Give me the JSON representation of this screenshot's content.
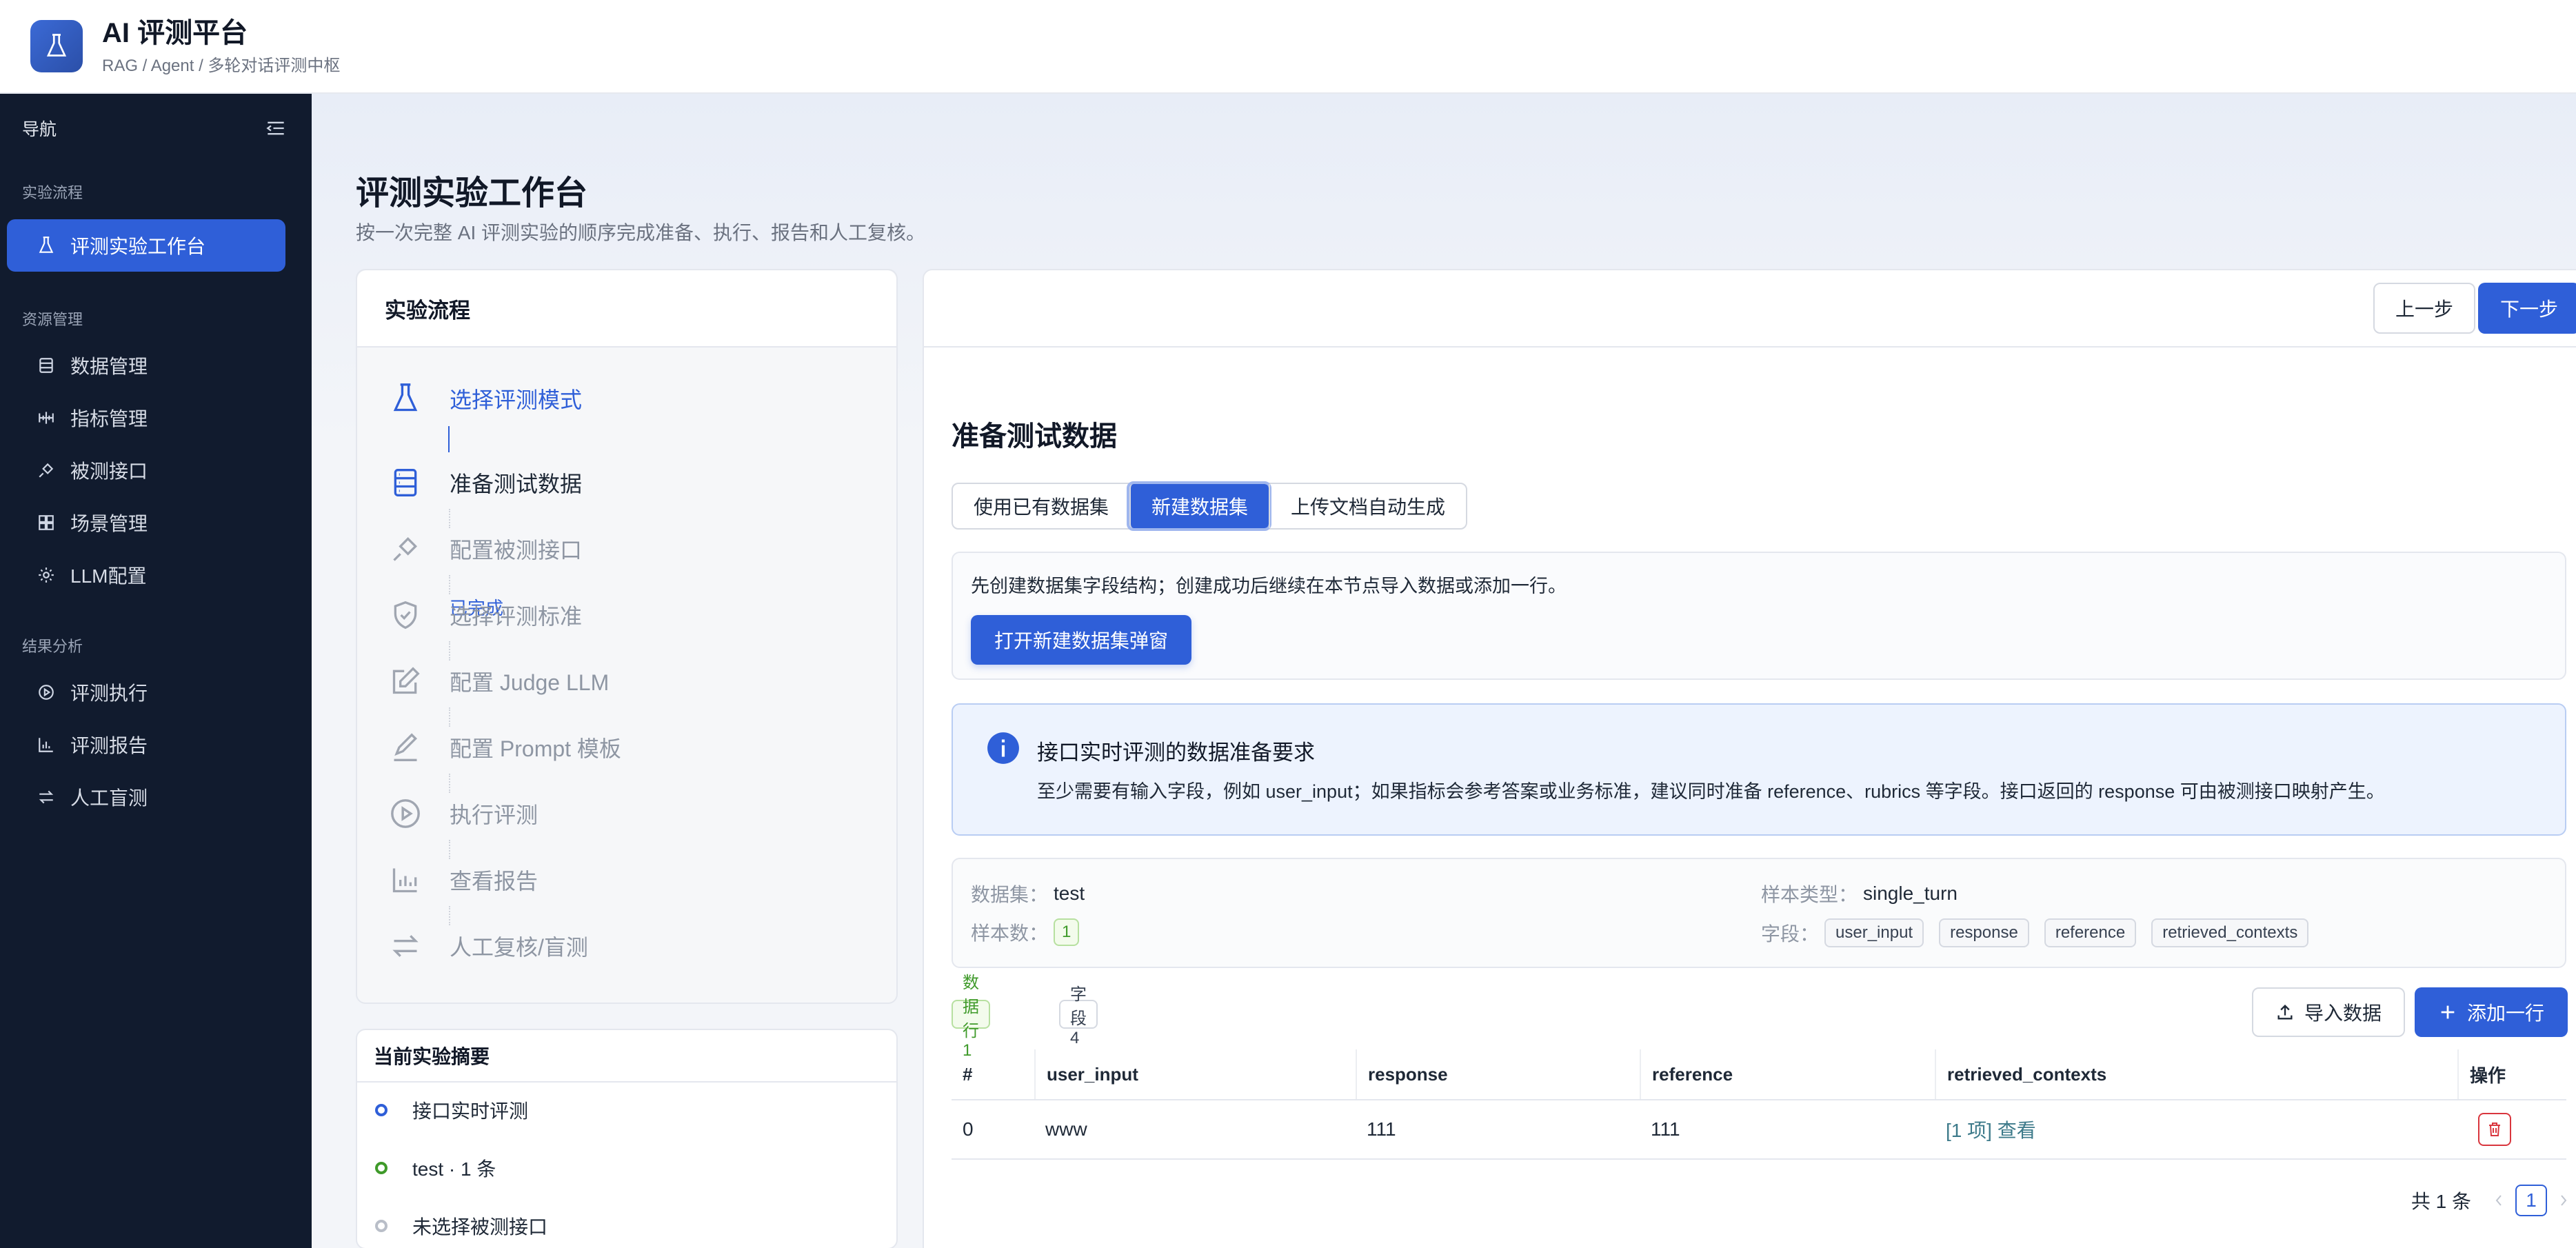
{
  "header": {
    "title": "AI 评测平台",
    "subtitle": "RAG / Agent / 多轮对话评测中枢"
  },
  "sidebar": {
    "nav_label": "导航",
    "sections": [
      {
        "label": "实验流程",
        "items": [
          {
            "label": "评测实验工作台",
            "icon": "flask-icon",
            "active": true
          }
        ]
      },
      {
        "label": "资源管理",
        "items": [
          {
            "label": "数据管理",
            "icon": "database-icon"
          },
          {
            "label": "指标管理",
            "icon": "metric-icon"
          },
          {
            "label": "被测接口",
            "icon": "plug-icon"
          },
          {
            "label": "场景管理",
            "icon": "grid-icon"
          },
          {
            "label": "LLM配置",
            "icon": "gear-icon"
          }
        ]
      },
      {
        "label": "结果分析",
        "items": [
          {
            "label": "评测执行",
            "icon": "play-icon"
          },
          {
            "label": "评测报告",
            "icon": "bar-chart-icon"
          },
          {
            "label": "人工盲测",
            "icon": "swap-icon"
          }
        ]
      }
    ]
  },
  "page": {
    "title": "评测实验工作台",
    "subtitle": "按一次完整 AI 评测实验的顺序完成准备、执行、报告和人工复核。"
  },
  "flow": {
    "title": "实验流程",
    "steps": [
      {
        "label": "选择评测模式",
        "status": "已完成",
        "icon": "flask-icon"
      },
      {
        "label": "准备测试数据",
        "icon": "database-icon"
      },
      {
        "label": "配置被测接口",
        "icon": "plug-icon"
      },
      {
        "label": "选择评测标准",
        "icon": "shield-check-icon"
      },
      {
        "label": "配置 Judge LLM",
        "icon": "edit-icon"
      },
      {
        "label": "配置 Prompt 模板",
        "icon": "pen-icon"
      },
      {
        "label": "执行评测",
        "icon": "play-icon"
      },
      {
        "label": "查看报告",
        "icon": "bar-chart-icon"
      },
      {
        "label": "人工复核/盲测",
        "icon": "swap-icon"
      }
    ]
  },
  "summary": {
    "title": "当前实验摘要",
    "items": [
      {
        "label": "接口实时评测",
        "color": "#2f5fd8"
      },
      {
        "label": "test · 1 条",
        "color": "#3f9a2a"
      },
      {
        "label": "未选择被测接口",
        "color": "#b9bec8"
      }
    ]
  },
  "toolbar": {
    "prev": "上一步",
    "next": "下一步"
  },
  "section": {
    "title": "准备测试数据",
    "modes": [
      "使用已有数据集",
      "新建数据集",
      "上传文档自动生成"
    ],
    "active_mode": "新建数据集"
  },
  "create": {
    "text": "先创建数据集字段结构；创建成功后继续在本节点导入数据或添加一行。",
    "button": "打开新建数据集弹窗"
  },
  "info": {
    "title": "接口实时评测的数据准备要求",
    "text": "至少需要有输入字段，例如 user_input；如果指标会参考答案或业务标准，建议同时准备 reference、rubrics 等字段。接口返回的 response 可由被测接口映射产生。"
  },
  "meta": {
    "dataset_label": "数据集：",
    "dataset": "test",
    "type_label": "样本类型：",
    "type": "single_turn",
    "count_label": "样本数：",
    "count": "1",
    "fields_label": "字段：",
    "fields": [
      "user_input",
      "response",
      "reference",
      "retrieved_contexts"
    ]
  },
  "tools": {
    "rows_tag": "数据行 1",
    "fields_tag": "字段 4",
    "import": "导入数据",
    "add": "添加一行"
  },
  "table": {
    "headers": [
      "#",
      "user_input",
      "response",
      "reference",
      "retrieved_contexts",
      "操作"
    ],
    "rows": [
      {
        "idx": "0",
        "user_input": "www",
        "response": "111",
        "reference": "111",
        "contexts": "[1 项] 查看"
      }
    ]
  },
  "pager": {
    "total": "共 1 条",
    "page": "1"
  },
  "colors": {
    "accent": "#2f5fd8",
    "sidebar_bg": "#111b2e",
    "success": "#3f9a2a",
    "danger": "#d9363e"
  }
}
